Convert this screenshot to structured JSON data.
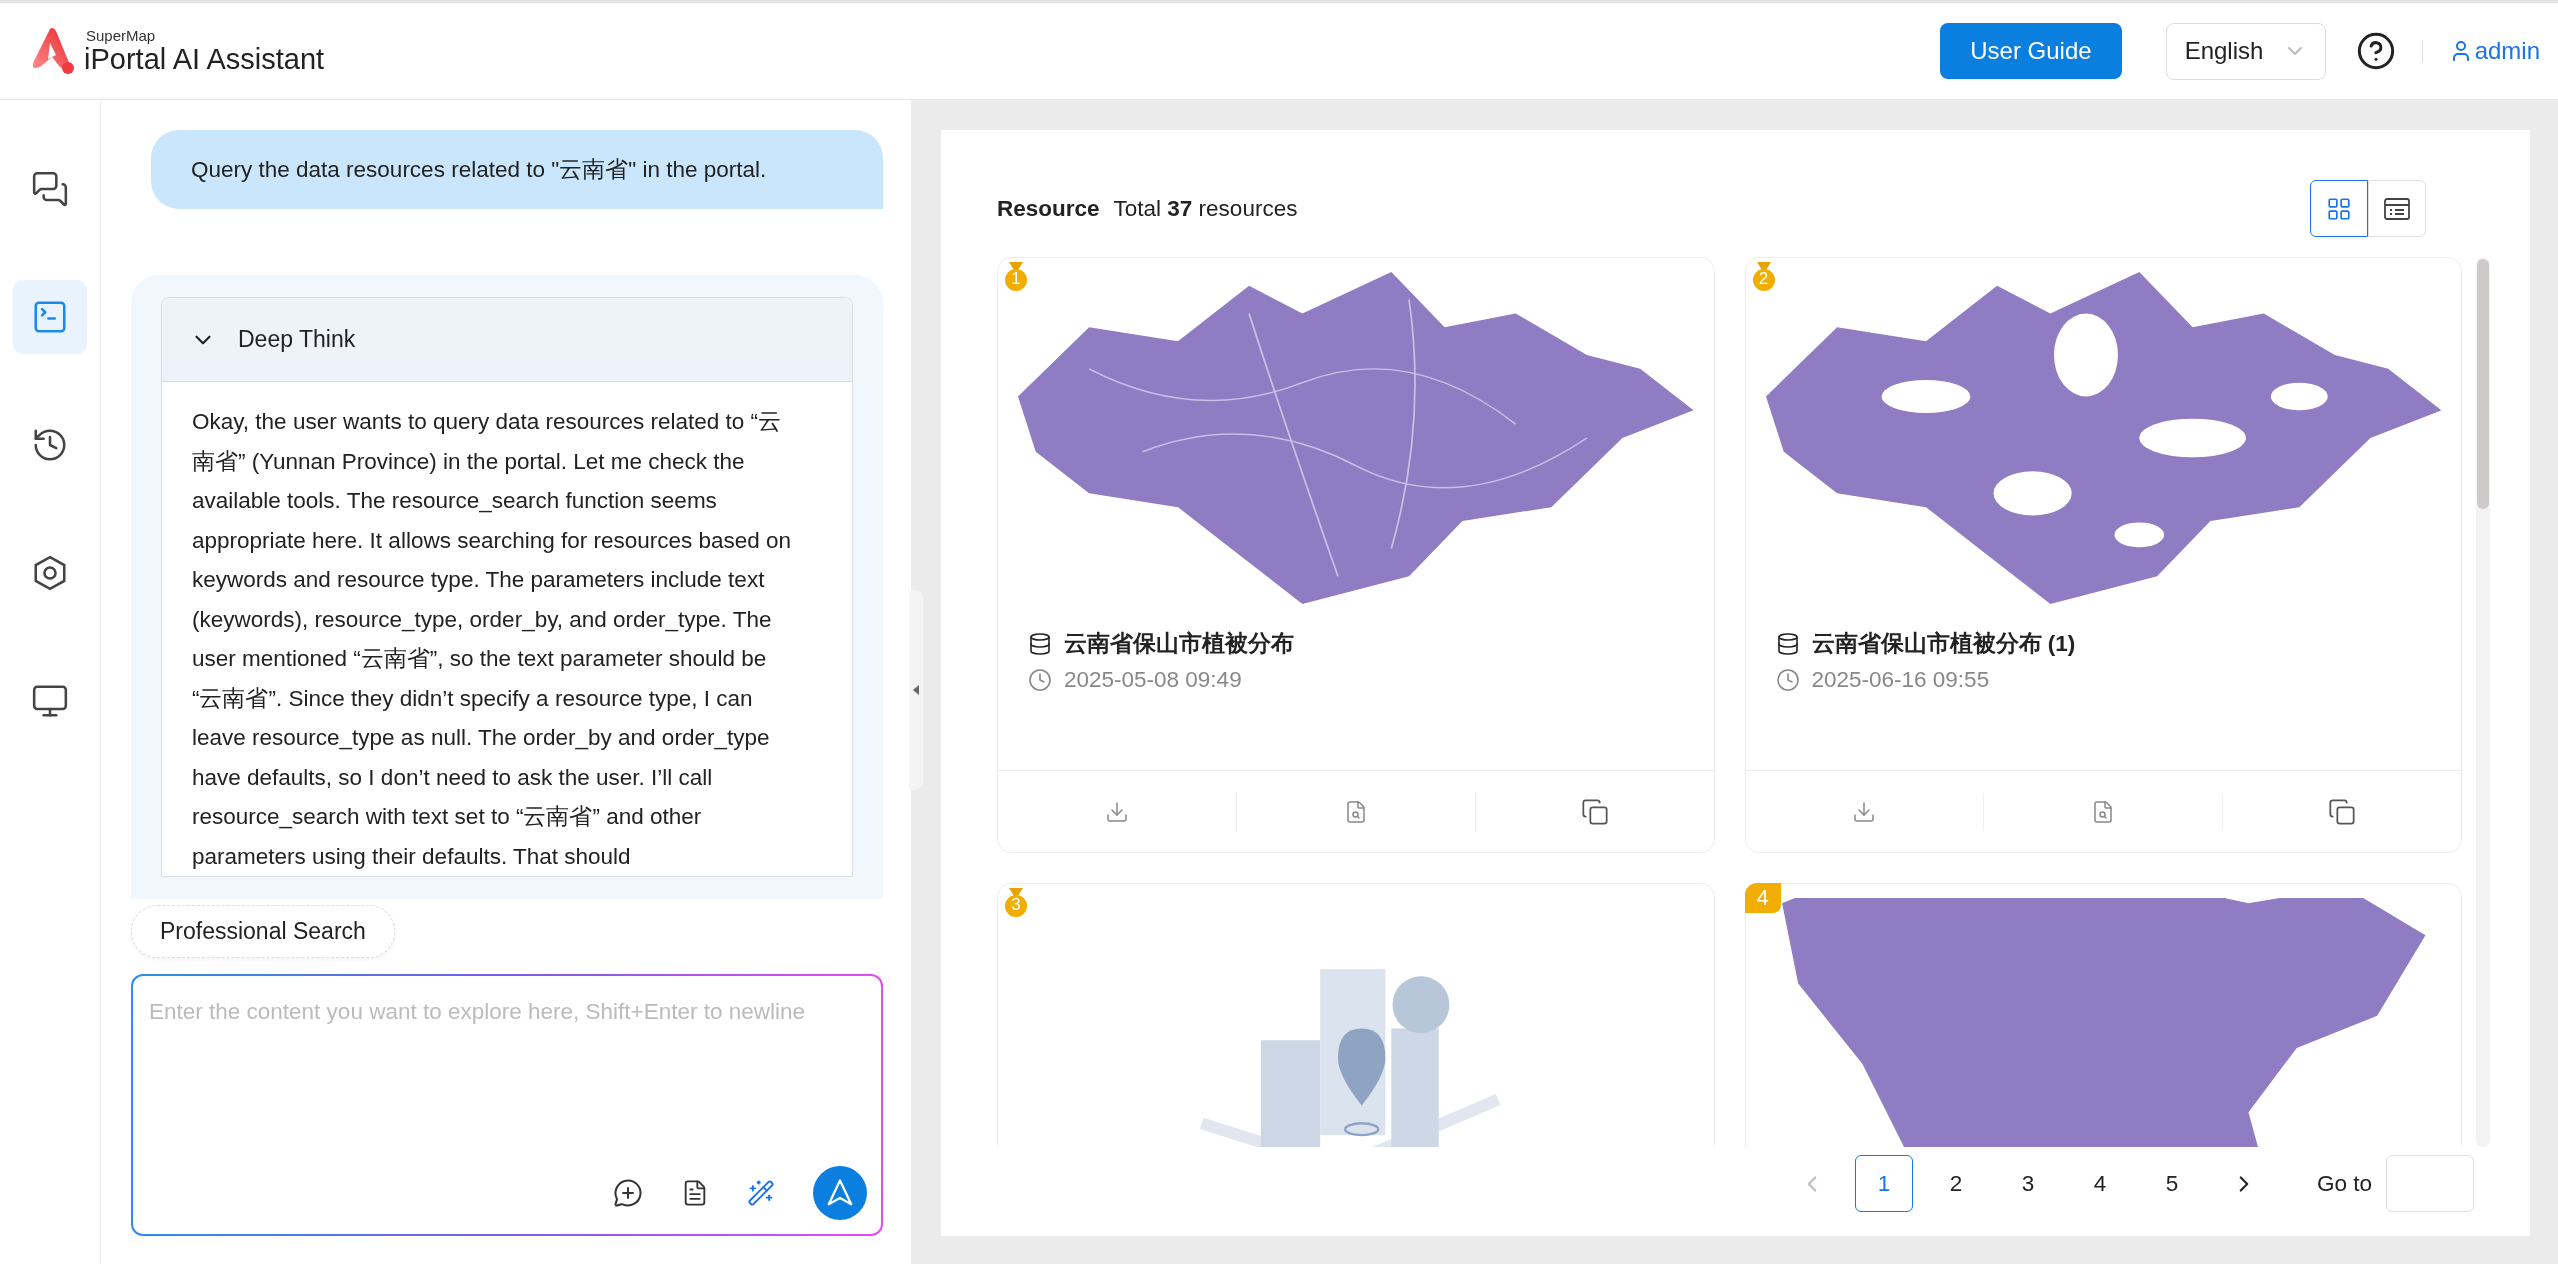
{
  "header": {
    "brand_small": "SuperMap",
    "brand": "iPortal AI Assistant",
    "guide_button": "User Guide",
    "language": "English",
    "user": "admin"
  },
  "rail": [
    {
      "kind": "chat",
      "selected": false
    },
    {
      "kind": "terminal",
      "selected": true
    },
    {
      "kind": "history",
      "selected": false
    },
    {
      "kind": "settings",
      "selected": false
    },
    {
      "kind": "monitor",
      "selected": false
    }
  ],
  "chat": {
    "user_message": "Query the data resources related to \"云南省\" in the portal.",
    "deep_think": {
      "title": "Deep Think",
      "expanded": true,
      "text": "Okay, the user wants to query data resources related to “云南省” (Yunnan Province) in the portal. Let me check the available tools. The resource_search function seems appropriate here. It allows searching for resources based on keywords and resource type. The parameters include text (keywords), resource_type, order_by, and order_type. The user mentioned “云南省”, so the text parameter should be “云南省”. Since they didn’t specify a resource type, I can leave resource_type as null. The order_by and order_type have defaults, so I don’t need to ask the user. I’ll call resource_search with text set to “云南省” and other parameters using their defaults. That should"
    },
    "chip": "Professional Search",
    "input": {
      "placeholder": "Enter the content you want to explore here, Shift+Enter to newline"
    }
  },
  "resources": {
    "title": "Resource",
    "total": "Total **37** resources",
    "views": [
      {
        "kind": "grid",
        "selected": true
      },
      {
        "kind": "list",
        "selected": false
      }
    ],
    "cards": [
      {
        "rank": {
          "kind": "medal",
          "label": "1"
        },
        "title": "云南省保山市植被分布",
        "date": "2025-05-08 09:49"
      },
      {
        "rank": {
          "kind": "medal",
          "label": "2"
        },
        "title": "云南省保山市植被分布 (1)",
        "date": "2025-06-16 09:55"
      },
      {
        "rank": {
          "kind": "medal",
          "label": "3"
        },
        "thumb": {
          "kind": "illustration"
        }
      },
      {
        "rank": {
          "kind": "tag",
          "label": "4"
        }
      }
    ]
  },
  "pagination": {
    "pages": [
      {
        "label": "1",
        "selected": true
      },
      {
        "label": "2",
        "selected": false
      },
      {
        "label": "3",
        "selected": false
      },
      {
        "label": "4",
        "selected": false
      },
      {
        "label": "5",
        "selected": false
      }
    ],
    "goto_label": "Go to"
  }
}
